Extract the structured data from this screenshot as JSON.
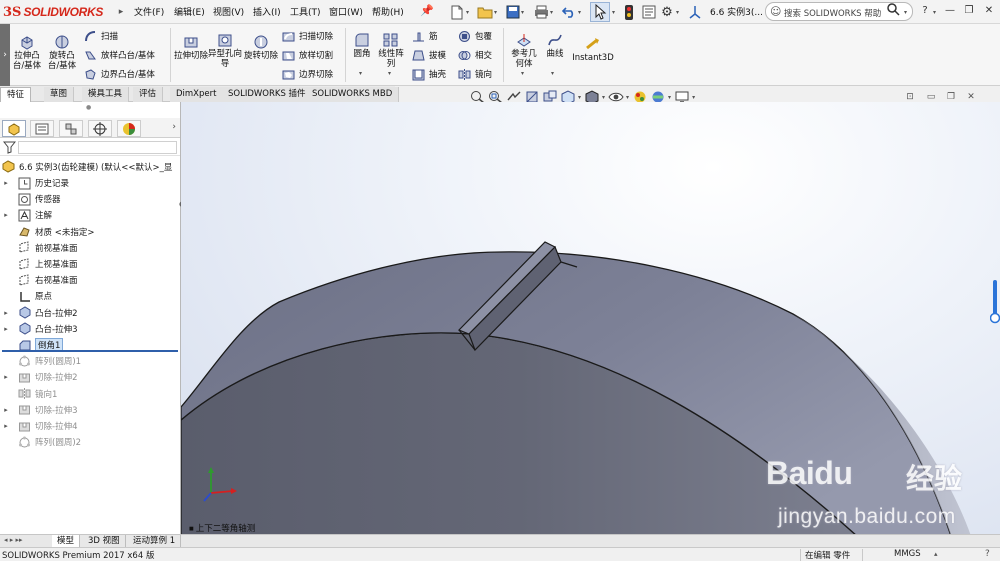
{
  "app": {
    "logo_ds": "3S",
    "logo_name": "SOLIDWORKS",
    "document_title": "6.6 实例3(..."
  },
  "menu": {
    "items": [
      "文件(F)",
      "编辑(E)",
      "视图(V)",
      "插入(I)",
      "工具(T)",
      "窗口(W)",
      "帮助(H)"
    ]
  },
  "help_search": {
    "placeholder": "搜索 SOLIDWORKS 帮助"
  },
  "window_controls": {
    "help": "?",
    "help_arrow": "▾",
    "minimize": "—",
    "restore": "❐",
    "close": "✕"
  },
  "ribbon": {
    "left_col": [
      "拉伸凸台/基体",
      "旋转凸台/基体"
    ],
    "small_col1": [
      "扫描",
      "放样凸台/基体",
      "边界凸台/基体"
    ],
    "big_col2": [
      "拉伸切除",
      "异型孔向导",
      "旋转切除"
    ],
    "small_col2": [
      "扫描切除",
      "放样切割",
      "边界切除"
    ],
    "big_col3": [
      "圆角",
      "线性阵列"
    ],
    "small_col3a": [
      "筋",
      "拔模",
      "抽壳"
    ],
    "small_col3b": [
      "包覆",
      "相交",
      "镜向"
    ],
    "big_col4": [
      "参考几何体",
      "曲线",
      "Instant3D"
    ]
  },
  "command_tabs": [
    {
      "label": "特征",
      "active": true
    },
    {
      "label": "草图",
      "active": false
    },
    {
      "label": "模具工具",
      "active": false
    },
    {
      "label": "评估",
      "active": false
    },
    {
      "label": "DimXpert",
      "active": false
    },
    {
      "label": "SOLIDWORKS 插件",
      "active": false
    },
    {
      "label": "SOLIDWORKS MBD",
      "active": false
    }
  ],
  "feature_tree": {
    "root": "6.6 实例3(齿轮建模)  (默认<<默认>_显",
    "items": [
      {
        "label": "历史记录",
        "expand": "▸",
        "icon": "history-icon",
        "state": "normal"
      },
      {
        "label": "传感器",
        "expand": "",
        "icon": "sensor-icon",
        "state": "normal"
      },
      {
        "label": "注解",
        "expand": "▸",
        "icon": "annotation-icon",
        "state": "normal"
      },
      {
        "label": "材质 <未指定>",
        "expand": "",
        "icon": "material-icon",
        "state": "normal"
      },
      {
        "label": "前视基准面",
        "expand": "",
        "icon": "plane-icon",
        "state": "normal"
      },
      {
        "label": "上视基准面",
        "expand": "",
        "icon": "plane-icon",
        "state": "normal"
      },
      {
        "label": "右视基准面",
        "expand": "",
        "icon": "plane-icon",
        "state": "normal"
      },
      {
        "label": "原点",
        "expand": "",
        "icon": "origin-icon",
        "state": "normal"
      },
      {
        "label": "凸台-拉伸2",
        "expand": "▸",
        "icon": "boss-extrude-icon",
        "state": "normal"
      },
      {
        "label": "凸台-拉伸3",
        "expand": "▸",
        "icon": "boss-extrude-icon",
        "state": "normal"
      },
      {
        "label": "倒角1",
        "expand": "",
        "icon": "chamfer-icon",
        "state": "selected"
      },
      {
        "label": "阵列(圆周)1",
        "expand": "",
        "icon": "circular-pattern-icon",
        "state": "suppressed"
      },
      {
        "label": "切除-拉伸2",
        "expand": "▸",
        "icon": "cut-extrude-icon",
        "state": "suppressed"
      },
      {
        "label": "镜向1",
        "expand": "",
        "icon": "mirror-icon",
        "state": "suppressed"
      },
      {
        "label": "切除-拉伸3",
        "expand": "▸",
        "icon": "cut-extrude-icon",
        "state": "suppressed"
      },
      {
        "label": "切除-拉伸4",
        "expand": "▸",
        "icon": "cut-extrude-icon",
        "state": "suppressed"
      },
      {
        "label": "阵列(圆周)2",
        "expand": "",
        "icon": "circular-pattern-icon",
        "state": "suppressed"
      }
    ]
  },
  "viewport": {
    "view_label": "上下二等角轴测"
  },
  "bottom_tabs": [
    {
      "label": "模型",
      "active": true
    },
    {
      "label": "3D 视图",
      "active": false
    },
    {
      "label": "运动算例 1",
      "active": false
    }
  ],
  "status": {
    "product": "SOLIDWORKS Premium 2017 x64 版",
    "mode": "在编辑 零件",
    "units": "MMGS"
  },
  "watermark": {
    "brand": "Baidu",
    "brand_cn": "经验",
    "url": "jingyan.baidu.com"
  },
  "colors": {
    "accent_red": "#d5281b",
    "selection_blue": "#2f5faa",
    "model_gray": "#74778a"
  }
}
